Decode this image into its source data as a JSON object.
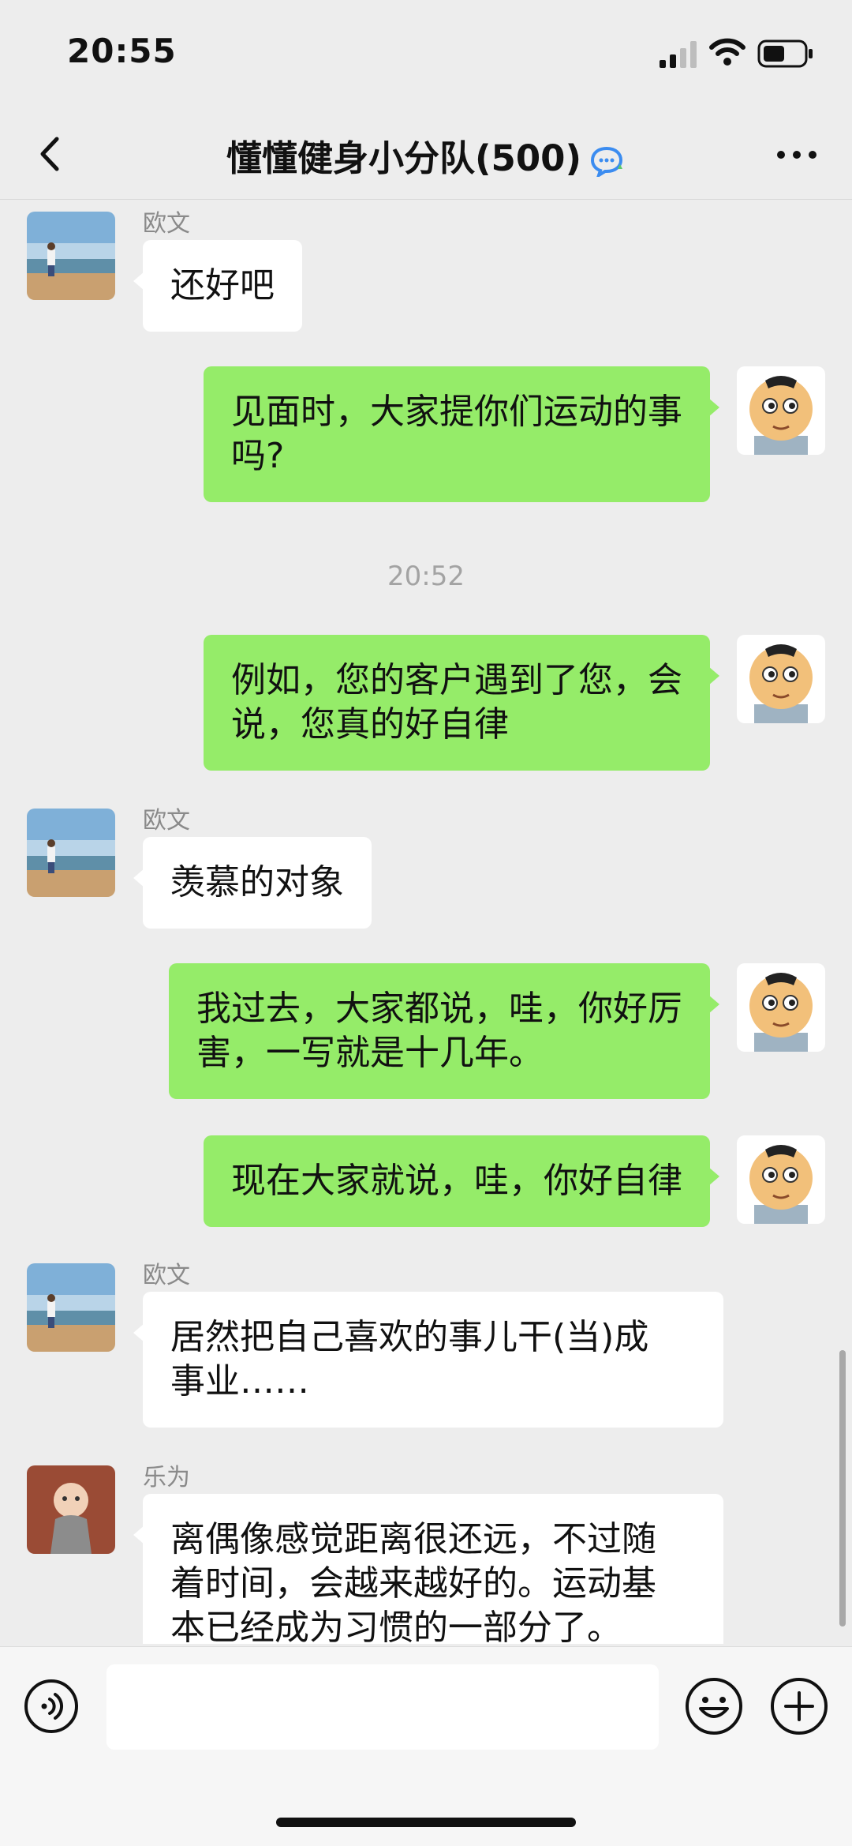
{
  "status": {
    "time": "20:55"
  },
  "nav": {
    "title": "懂懂健身小分队(500)"
  },
  "messages": [
    {
      "side": "in",
      "sender": "欧文",
      "lines": [
        "还好吧"
      ]
    },
    {
      "side": "out",
      "lines": [
        "见面时，大家提你们运动的事",
        "吗?"
      ]
    },
    {
      "timestamp": "20:52"
    },
    {
      "side": "out",
      "lines": [
        "例如，您的客户遇到了您，会",
        "说，您真的好自律"
      ]
    },
    {
      "side": "in",
      "sender": "欧文",
      "lines": [
        "羡慕的对象"
      ]
    },
    {
      "side": "out",
      "lines": [
        "我过去，大家都说，哇，你好厉",
        "害，一写就是十几年。"
      ]
    },
    {
      "side": "out",
      "lines": [
        "现在大家就说，哇，你好自律"
      ]
    },
    {
      "side": "in",
      "sender": "欧文",
      "lines": [
        "居然把自己喜欢的事儿干(当)成",
        "事业……"
      ]
    },
    {
      "side": "in",
      "sender": "乐为",
      "lines": [
        "离偶像感觉距离很还远，不过随",
        "着时间，会越来越好的。运动基",
        "本已经成为习惯的一部分了。"
      ]
    }
  ],
  "colors": {
    "outgoing_bubble": "#95ec69",
    "incoming_bubble": "#ffffff",
    "background": "#ededed"
  },
  "icons": [
    "back-arrow-icon",
    "ai-chat-icon",
    "more-icon",
    "voice-icon",
    "emoji-icon",
    "plus-icon",
    "signal-icon",
    "wifi-icon",
    "battery-icon"
  ]
}
